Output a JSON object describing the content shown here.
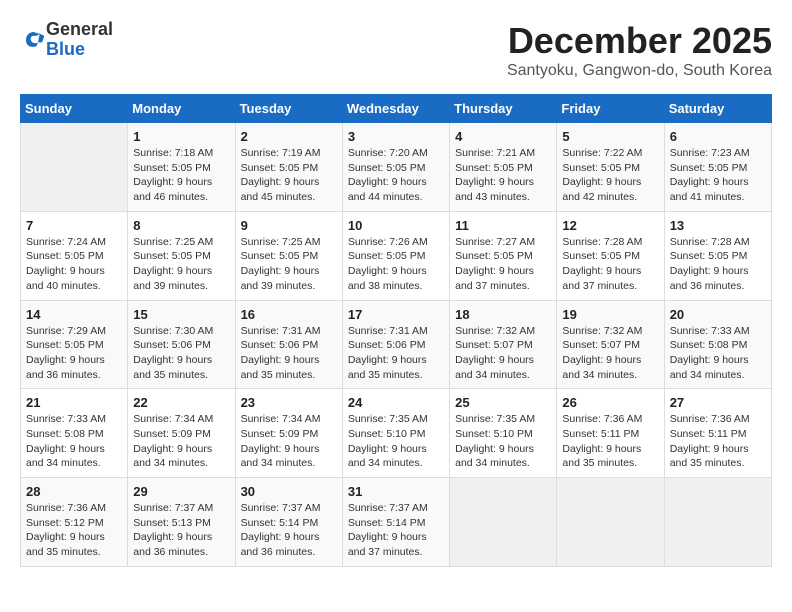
{
  "header": {
    "logo_general": "General",
    "logo_blue": "Blue",
    "title": "December 2025",
    "subtitle": "Santyoku, Gangwon-do, South Korea"
  },
  "days_of_week": [
    "Sunday",
    "Monday",
    "Tuesday",
    "Wednesday",
    "Thursday",
    "Friday",
    "Saturday"
  ],
  "weeks": [
    [
      {
        "day": "",
        "info": ""
      },
      {
        "day": "1",
        "info": "Sunrise: 7:18 AM\nSunset: 5:05 PM\nDaylight: 9 hours\nand 46 minutes."
      },
      {
        "day": "2",
        "info": "Sunrise: 7:19 AM\nSunset: 5:05 PM\nDaylight: 9 hours\nand 45 minutes."
      },
      {
        "day": "3",
        "info": "Sunrise: 7:20 AM\nSunset: 5:05 PM\nDaylight: 9 hours\nand 44 minutes."
      },
      {
        "day": "4",
        "info": "Sunrise: 7:21 AM\nSunset: 5:05 PM\nDaylight: 9 hours\nand 43 minutes."
      },
      {
        "day": "5",
        "info": "Sunrise: 7:22 AM\nSunset: 5:05 PM\nDaylight: 9 hours\nand 42 minutes."
      },
      {
        "day": "6",
        "info": "Sunrise: 7:23 AM\nSunset: 5:05 PM\nDaylight: 9 hours\nand 41 minutes."
      }
    ],
    [
      {
        "day": "7",
        "info": "Sunrise: 7:24 AM\nSunset: 5:05 PM\nDaylight: 9 hours\nand 40 minutes."
      },
      {
        "day": "8",
        "info": "Sunrise: 7:25 AM\nSunset: 5:05 PM\nDaylight: 9 hours\nand 39 minutes."
      },
      {
        "day": "9",
        "info": "Sunrise: 7:25 AM\nSunset: 5:05 PM\nDaylight: 9 hours\nand 39 minutes."
      },
      {
        "day": "10",
        "info": "Sunrise: 7:26 AM\nSunset: 5:05 PM\nDaylight: 9 hours\nand 38 minutes."
      },
      {
        "day": "11",
        "info": "Sunrise: 7:27 AM\nSunset: 5:05 PM\nDaylight: 9 hours\nand 37 minutes."
      },
      {
        "day": "12",
        "info": "Sunrise: 7:28 AM\nSunset: 5:05 PM\nDaylight: 9 hours\nand 37 minutes."
      },
      {
        "day": "13",
        "info": "Sunrise: 7:28 AM\nSunset: 5:05 PM\nDaylight: 9 hours\nand 36 minutes."
      }
    ],
    [
      {
        "day": "14",
        "info": "Sunrise: 7:29 AM\nSunset: 5:05 PM\nDaylight: 9 hours\nand 36 minutes."
      },
      {
        "day": "15",
        "info": "Sunrise: 7:30 AM\nSunset: 5:06 PM\nDaylight: 9 hours\nand 35 minutes."
      },
      {
        "day": "16",
        "info": "Sunrise: 7:31 AM\nSunset: 5:06 PM\nDaylight: 9 hours\nand 35 minutes."
      },
      {
        "day": "17",
        "info": "Sunrise: 7:31 AM\nSunset: 5:06 PM\nDaylight: 9 hours\nand 35 minutes."
      },
      {
        "day": "18",
        "info": "Sunrise: 7:32 AM\nSunset: 5:07 PM\nDaylight: 9 hours\nand 34 minutes."
      },
      {
        "day": "19",
        "info": "Sunrise: 7:32 AM\nSunset: 5:07 PM\nDaylight: 9 hours\nand 34 minutes."
      },
      {
        "day": "20",
        "info": "Sunrise: 7:33 AM\nSunset: 5:08 PM\nDaylight: 9 hours\nand 34 minutes."
      }
    ],
    [
      {
        "day": "21",
        "info": "Sunrise: 7:33 AM\nSunset: 5:08 PM\nDaylight: 9 hours\nand 34 minutes."
      },
      {
        "day": "22",
        "info": "Sunrise: 7:34 AM\nSunset: 5:09 PM\nDaylight: 9 hours\nand 34 minutes."
      },
      {
        "day": "23",
        "info": "Sunrise: 7:34 AM\nSunset: 5:09 PM\nDaylight: 9 hours\nand 34 minutes."
      },
      {
        "day": "24",
        "info": "Sunrise: 7:35 AM\nSunset: 5:10 PM\nDaylight: 9 hours\nand 34 minutes."
      },
      {
        "day": "25",
        "info": "Sunrise: 7:35 AM\nSunset: 5:10 PM\nDaylight: 9 hours\nand 34 minutes."
      },
      {
        "day": "26",
        "info": "Sunrise: 7:36 AM\nSunset: 5:11 PM\nDaylight: 9 hours\nand 35 minutes."
      },
      {
        "day": "27",
        "info": "Sunrise: 7:36 AM\nSunset: 5:11 PM\nDaylight: 9 hours\nand 35 minutes."
      }
    ],
    [
      {
        "day": "28",
        "info": "Sunrise: 7:36 AM\nSunset: 5:12 PM\nDaylight: 9 hours\nand 35 minutes."
      },
      {
        "day": "29",
        "info": "Sunrise: 7:37 AM\nSunset: 5:13 PM\nDaylight: 9 hours\nand 36 minutes."
      },
      {
        "day": "30",
        "info": "Sunrise: 7:37 AM\nSunset: 5:14 PM\nDaylight: 9 hours\nand 36 minutes."
      },
      {
        "day": "31",
        "info": "Sunrise: 7:37 AM\nSunset: 5:14 PM\nDaylight: 9 hours\nand 37 minutes."
      },
      {
        "day": "",
        "info": ""
      },
      {
        "day": "",
        "info": ""
      },
      {
        "day": "",
        "info": ""
      }
    ]
  ]
}
